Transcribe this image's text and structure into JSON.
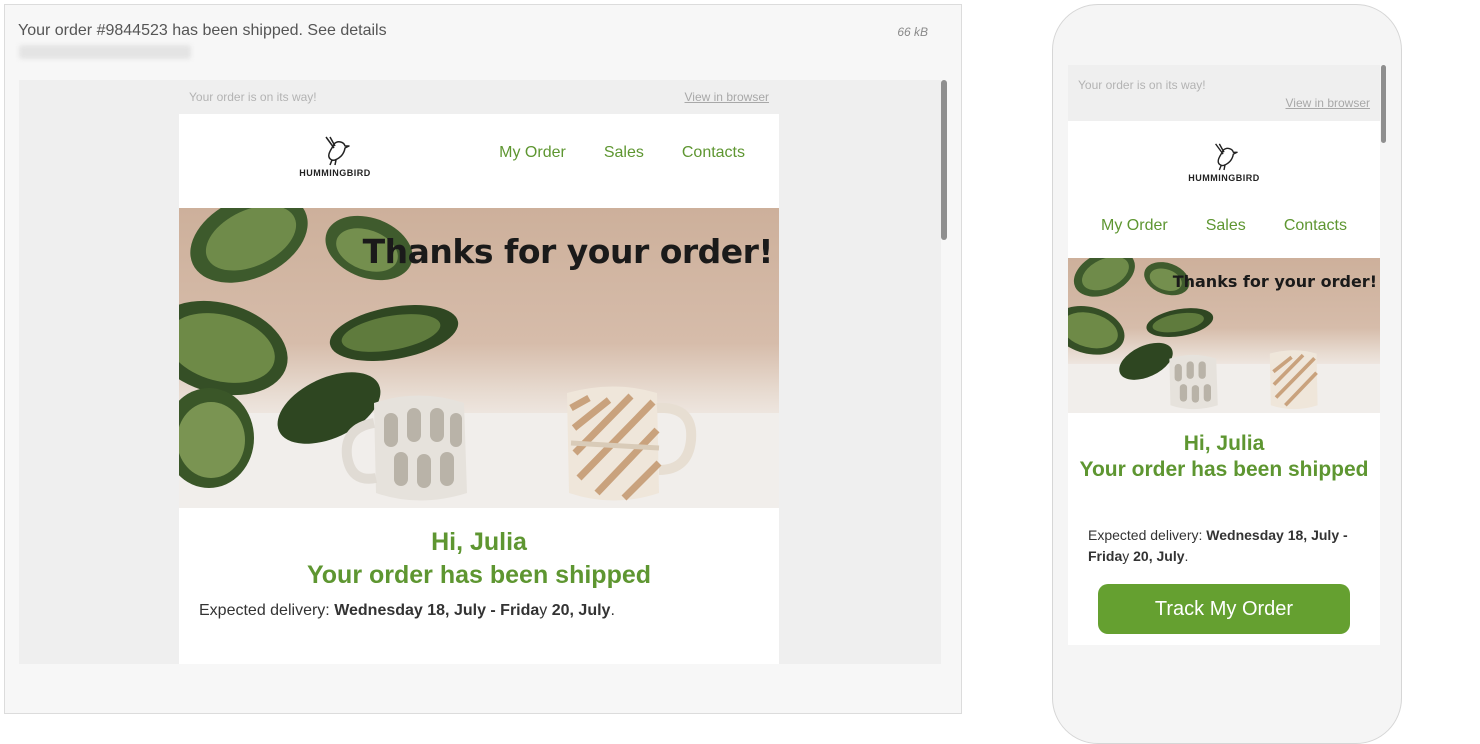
{
  "message": {
    "subject": "Your order #9844523 has been shipped. See details",
    "size": "66 kB"
  },
  "preheader": {
    "text": "Your order is on its way!",
    "view_link": "View in browser"
  },
  "brand": {
    "logo_text": "HUMMINGBIRD"
  },
  "nav": {
    "items": [
      {
        "label": "My Order"
      },
      {
        "label": "Sales"
      },
      {
        "label": "Contacts"
      }
    ]
  },
  "hero": {
    "title": "Thanks for your order!"
  },
  "body": {
    "greeting": "Hi, Julia",
    "headline": "Your order has been shipped",
    "delivery_label": "Expected delivery: ",
    "delivery_date_a": "Wednesday 18, July - Frida",
    "delivery_mid": "y",
    "delivery_date_b": " 20, July",
    "delivery_end": "."
  },
  "cta": {
    "label": "Track My Order"
  },
  "colors": {
    "accent_green": "#5e9631",
    "button_green": "#65a030"
  }
}
